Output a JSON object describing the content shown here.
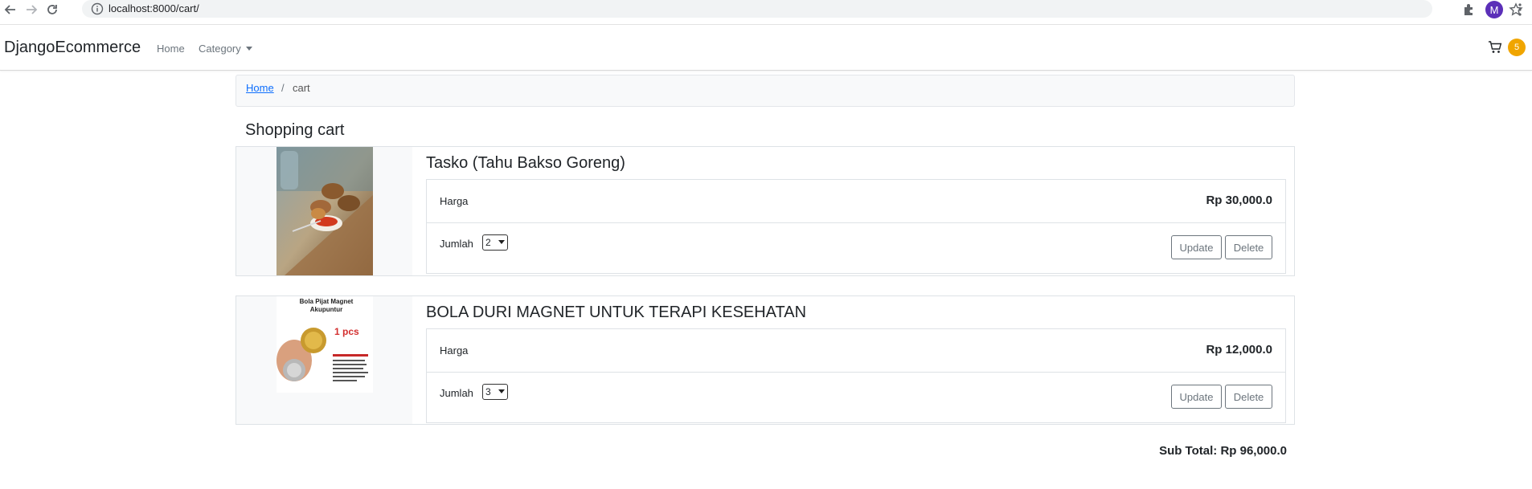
{
  "browser": {
    "url": "localhost:8000/cart/",
    "profile_initial": "M"
  },
  "navbar": {
    "brand": "DjangoEcommerce",
    "links": [
      "Home",
      "Category"
    ],
    "cart_count": "5"
  },
  "breadcrumb": {
    "home": "Home",
    "separator": "/",
    "current": "cart"
  },
  "page_title": "Shopping cart",
  "items": [
    {
      "title": "Tasko (Tahu Bakso Goreng)",
      "price_label": "Harga",
      "price": "Rp 30,000.0",
      "qty_label": "Jumlah",
      "qty": "2",
      "update_label": "Update",
      "delete_label": "Delete",
      "image_icon": "food-photo"
    },
    {
      "title": "BOLA DURI MAGNET UNTUK TERAPI KESEHATAN",
      "price_label": "Harga",
      "price": "Rp 12,000.0",
      "qty_label": "Jumlah",
      "qty": "3",
      "update_label": "Update",
      "delete_label": "Delete",
      "image_icon": "product-photo",
      "image_text": {
        "heading": "Bola Pijat Magnet Akupuntur",
        "badge": "1 pcs"
      }
    }
  ],
  "subtotal": "Sub Total: Rp 96,000.0",
  "colors": {
    "accent": "#0d6efd",
    "badge": "#f0a500",
    "profile": "#5b2fb8"
  }
}
